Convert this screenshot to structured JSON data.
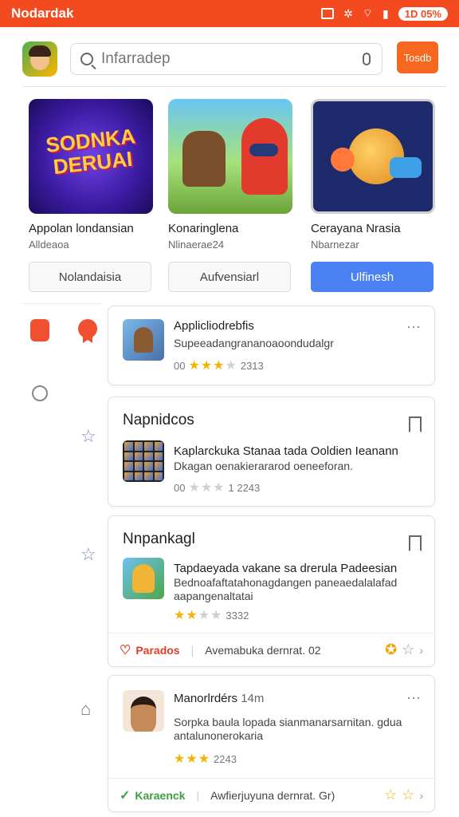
{
  "status_bar": {
    "app_name": "Nodardak",
    "battery": "1D 05%"
  },
  "search": {
    "placeholder": "Infarradep"
  },
  "top_button": {
    "label": "Tosdb"
  },
  "featured": [
    {
      "art_text": "SODNKA DERUAI",
      "title": "Appolan londansian",
      "subtitle": "Alldeaoa",
      "button": "Nolandaisia",
      "primary": false
    },
    {
      "title": "Konaringlena",
      "subtitle": "Nlinaerae24",
      "button": "Aufvensiarl",
      "primary": false
    },
    {
      "title": "Cerayana Nrasia",
      "subtitle": "Nbarnezar",
      "button": "Ulfinesh",
      "primary": true
    }
  ],
  "cards": [
    {
      "title": "Applicliodrebfis",
      "desc": "Supeeadangrananoaoondudalgr",
      "rating_prefix": "00",
      "stars": 3,
      "count": "2313"
    },
    {
      "heading": "Napnidcos",
      "title": "Kaplarckuka Stanaa tada Ooldien Ieanann",
      "desc": "Dkagan oenakierararod oeneeforan.",
      "rating_prefix": "00",
      "stars": 2,
      "count": "1 2243"
    },
    {
      "heading": "Nnpankagl",
      "title": "Tapdaeyada vakane sa drerula Padeesian",
      "desc": "Bednoafaftatahonagdangen paneaedalalafad aapangenaltatai",
      "rating_prefix": "",
      "stars": 2,
      "count": "3332",
      "footer_tag": "Parados",
      "footer_text": "Avemabuka dernrat. 02"
    },
    {
      "title": "Manorlrdérs",
      "title_suffix": "14m",
      "desc": "Sorpka baula lopada sianmanarsarnitan. gdua antalunonerokaria",
      "rating_prefix": "",
      "stars": 3,
      "count": "2243",
      "footer_tag": "Karaenck",
      "footer_text": "Awfierjuyuna dernrat. Gr)"
    }
  ],
  "colors": {
    "brand": "#f34a1f",
    "accent_orange": "#f7671d",
    "accent_blue": "#4a82f4",
    "star": "#f4b400"
  }
}
